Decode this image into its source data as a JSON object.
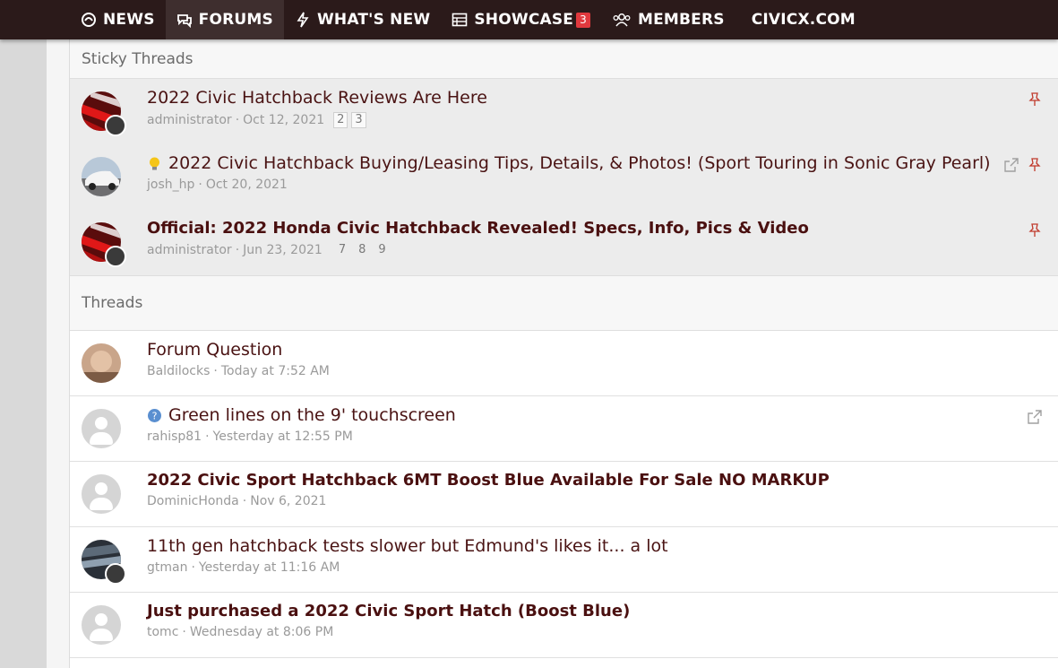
{
  "nav": {
    "items": [
      {
        "label": "NEWS",
        "icon": "news-icon"
      },
      {
        "label": "FORUMS",
        "icon": "forums-icon"
      },
      {
        "label": "WHAT'S NEW",
        "icon": "bolt-icon"
      },
      {
        "label": "SHOWCASE",
        "icon": "showcase-icon",
        "badge": "3"
      },
      {
        "label": "MEMBERS",
        "icon": "members-icon"
      },
      {
        "label": "CIVICX.COM"
      }
    ],
    "active": "FORUMS"
  },
  "sticky": {
    "heading": "Sticky Threads",
    "threads": [
      {
        "title": "2022 Civic Hatchback Reviews Are Here",
        "author": "administrator",
        "date": "Oct 12, 2021",
        "pages": [
          "2",
          "3"
        ],
        "pinned": true
      },
      {
        "title": "2022 Civic Hatchback Buying/Leasing Tips, Details, & Photos! (Sport Touring in Sonic Gray Pearl)",
        "prefix_icon": "lightbulb-icon",
        "author": "josh_hp",
        "date": "Oct 20, 2021",
        "pinned": true,
        "redirect": true
      },
      {
        "title": "Official: 2022 Honda Civic Hatchback Revealed! Specs, Info, Pics & Video",
        "unread": true,
        "author": "administrator",
        "date": "Jun 23, 2021",
        "pages": [
          "7",
          "8",
          "9"
        ],
        "pinned": true
      }
    ]
  },
  "threads": {
    "heading": "Threads",
    "items": [
      {
        "title": "Forum Question",
        "author": "Baldilocks",
        "date": "Today at 7:52 AM"
      },
      {
        "title": "Green lines on the 9' touchscreen",
        "prefix_icon": "question-icon",
        "author": "rahisp81",
        "date": "Yesterday at 12:55 PM",
        "redirect": true
      },
      {
        "title": "2022 Civic Sport Hatchback 6MT Boost Blue Available For Sale NO MARKUP",
        "unread": true,
        "author": "DominicHonda",
        "date": "Nov 6, 2021"
      },
      {
        "title": "11th gen hatchback tests slower but Edmund's likes it... a lot",
        "author": "gtman",
        "date": "Yesterday at 11:16 AM"
      },
      {
        "title": "Just purchased a 2022 Civic Sport Hatch (Boost Blue)",
        "unread": true,
        "author": "tomc",
        "date": "Wednesday at 8:06 PM"
      }
    ]
  },
  "colors": {
    "nav_bg": "#2b1a1a",
    "title": "#4a1313",
    "badge": "#e0393e",
    "pin": "#c0392b"
  }
}
